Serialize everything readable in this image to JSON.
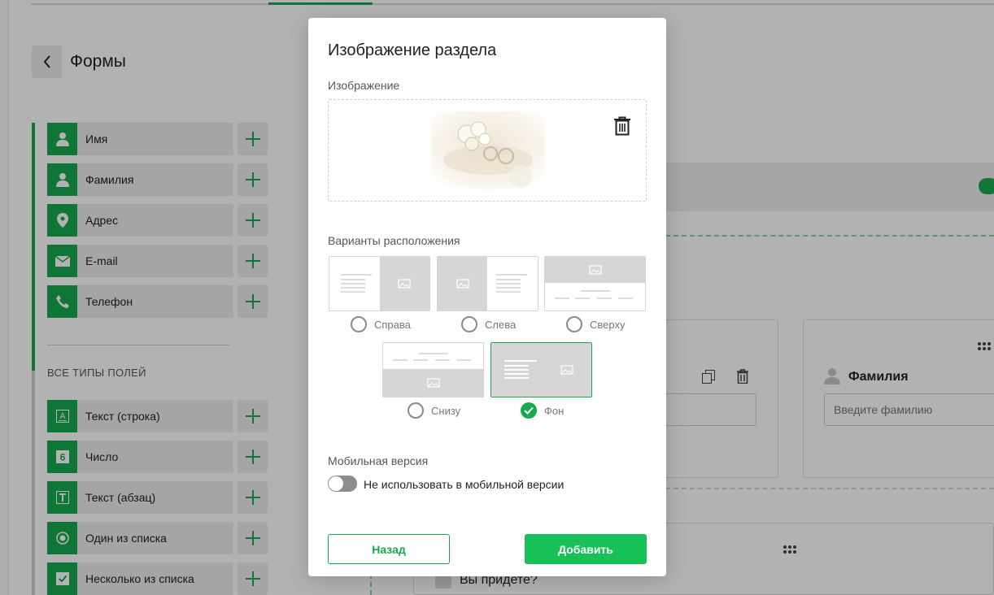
{
  "page": {
    "title": "Формы",
    "section_all_types": "ВСЕ ТИПЫ ПОЛЕЙ"
  },
  "quick_fields": [
    {
      "label": "Имя",
      "icon": "user-icon"
    },
    {
      "label": "Фамилия",
      "icon": "user-icon"
    },
    {
      "label": "Адрес",
      "icon": "location-pin-icon"
    },
    {
      "label": "E-mail",
      "icon": "envelope-icon"
    },
    {
      "label": "Телефон",
      "icon": "phone-icon"
    }
  ],
  "field_types": [
    {
      "label": "Текст (строка)",
      "icon": "text-line-icon"
    },
    {
      "label": "Число",
      "icon": "number-icon"
    },
    {
      "label": "Текст (абзац)",
      "icon": "text-paragraph-icon"
    },
    {
      "label": "Один из списка",
      "icon": "radio-icon"
    },
    {
      "label": "Несколько из списка",
      "icon": "checkbox-icon"
    }
  ],
  "canvas": {
    "surname_label": "Фамилия",
    "surname_placeholder": "Введите фамилию",
    "question": "Вы придете?"
  },
  "modal": {
    "title": "Изображение раздела",
    "image_label": "Изображение",
    "layout_label": "Варианты расположения",
    "layouts": [
      {
        "label": "Справа",
        "selected": false
      },
      {
        "label": "Слева",
        "selected": false
      },
      {
        "label": "Сверху",
        "selected": false
      },
      {
        "label": "Снизу",
        "selected": false
      },
      {
        "label": "Фон",
        "selected": true
      }
    ],
    "mobile_label": "Мобильная версия",
    "mobile_toggle_label": "Не использовать в мобильной версии",
    "mobile_toggle_on": false,
    "back_button": "Назад",
    "add_button": "Добавить"
  },
  "colors": {
    "accent": "#18a94f",
    "primary_button": "#18c058"
  }
}
